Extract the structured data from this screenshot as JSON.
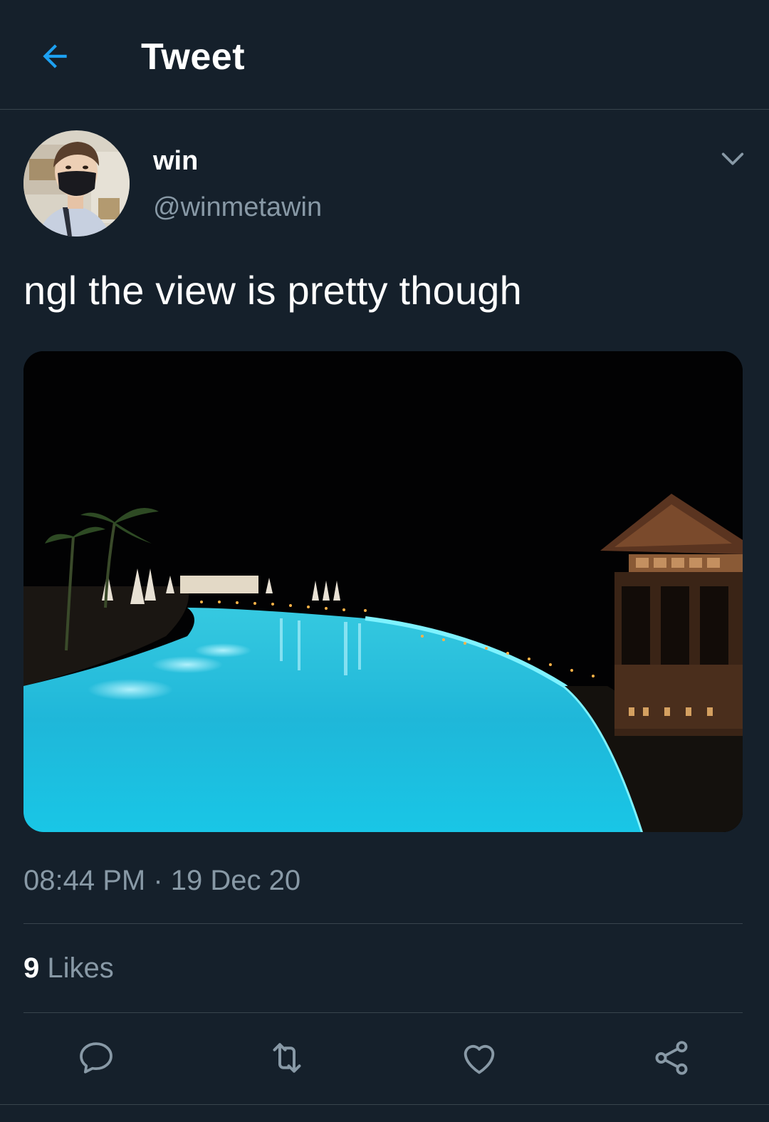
{
  "header": {
    "title": "Tweet",
    "back_icon": "arrow-left-icon"
  },
  "author": {
    "name": "win",
    "handle": "@winmetawin",
    "avatar_icon": "avatar-photo"
  },
  "tweet": {
    "text": "ngl the view is pretty though",
    "media_icon": "night-pool-photo",
    "time": "08:44 PM",
    "separator": "·",
    "date": "19 Dec 20"
  },
  "stats": {
    "likes_count": "9",
    "likes_label": "Likes"
  },
  "actions": {
    "reply_icon": "reply-icon",
    "retweet_icon": "retweet-icon",
    "like_icon": "heart-icon",
    "share_icon": "share-icon"
  },
  "colors": {
    "background": "#15202b",
    "accent": "#1da1f2",
    "secondary_text": "#8899a6",
    "divider": "#38444d"
  }
}
